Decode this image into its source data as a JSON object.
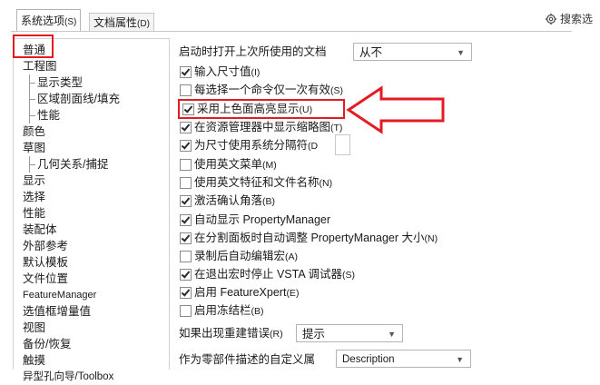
{
  "tabs": [
    {
      "label": "系统选项",
      "shortcut": "(S)"
    },
    {
      "label": "文档属性",
      "shortcut": "(D)"
    }
  ],
  "search": {
    "label": "搜索选",
    "icon": "gear-search-icon"
  },
  "tree": [
    "普通",
    "工程图",
    "显示类型",
    "区域剖面线/填充",
    "性能",
    "颜色",
    "草图",
    "几何关系/捕捉",
    "显示",
    "选择",
    "性能",
    "装配体",
    "外部参考",
    "默认模板",
    "文件位置",
    "FeatureManager",
    "选值框增量值",
    "视图",
    "备份/恢复",
    "触摸",
    "异型孔向导/Toolbox"
  ],
  "options": {
    "open_last_doc": {
      "label": "启动时打开上次所使用的文档",
      "value": "从不"
    },
    "items": [
      {
        "main": "输入尺寸值",
        "key": "(I)",
        "checked": true
      },
      {
        "main": "每选择一个命令仅一次有效",
        "key": "(S)",
        "checked": false
      },
      {
        "main": "采用上色面高亮显示",
        "key": "(U)",
        "checked": true
      },
      {
        "main": "在资源管理器中显示缩略图",
        "key": "(T)",
        "checked": true
      },
      {
        "main": "为尺寸使用系统分隔符",
        "key": "(D",
        "checked": true
      },
      {
        "main": "使用英文菜单",
        "key": "(M)",
        "checked": false
      },
      {
        "main": "使用英文特征和文件名称",
        "key": "(N)",
        "checked": false
      },
      {
        "main": "激活确认角落",
        "key": "(B)",
        "checked": true
      },
      {
        "main": "自动显示 PropertyManager",
        "key": "",
        "checked": true
      },
      {
        "main": "在分割面板时自动调整 PropertyManager 大小",
        "key": "(N)",
        "checked": true
      },
      {
        "main": "录制后自动编辑宏",
        "key": "(A)",
        "checked": false
      },
      {
        "main": "在退出宏时停止 VSTA 调试器",
        "key": "(S)",
        "checked": true
      },
      {
        "main": "启用 FeatureXpert",
        "key": "(E)",
        "checked": true
      },
      {
        "main": "启用冻结栏",
        "key": "(B)",
        "checked": false
      }
    ],
    "rebuild_error": {
      "label": "如果出现重建错误",
      "key": "(R)",
      "value": "提示"
    },
    "custom_prop": {
      "label": "作为零部件描述的自定义属",
      "value": "Description"
    }
  }
}
